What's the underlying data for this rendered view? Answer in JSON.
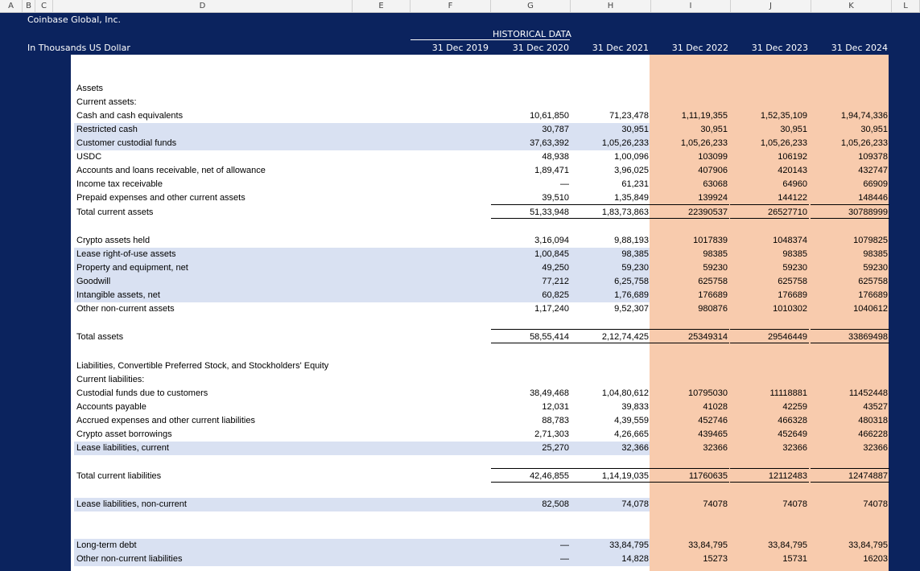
{
  "columns": [
    "A",
    "B",
    "C",
    "D",
    "E",
    "F",
    "G",
    "H",
    "I",
    "J",
    "K",
    "L"
  ],
  "company": "Coinbase Global, Inc.",
  "units": "In Thousands US Dollar",
  "historical_label": "HISTORICAL DATA",
  "periods": [
    "31 Dec 2019",
    "31 Dec 2020",
    "31 Dec 2021",
    "31 Dec 2022",
    "31 Dec 2023",
    "31 Dec 2024"
  ],
  "rows": [
    {
      "label": "Assets",
      "g": "",
      "h": "",
      "i": "",
      "j": "",
      "k": ""
    },
    {
      "label": "Current assets:",
      "g": "",
      "h": "",
      "i": "",
      "j": "",
      "k": ""
    },
    {
      "label": "Cash and cash equivalents",
      "g": "10,61,850",
      "h": "71,23,478",
      "i": "1,11,19,355",
      "j": "1,52,35,109",
      "k": "1,94,74,336"
    },
    {
      "label": "Restricted cash",
      "g": "30,787",
      "h": "30,951",
      "i": "30,951",
      "j": "30,951",
      "k": "30,951"
    },
    {
      "label": "Customer custodial funds",
      "g": "37,63,392",
      "h": "1,05,26,233",
      "i": "1,05,26,233",
      "j": "1,05,26,233",
      "k": "1,05,26,233"
    },
    {
      "label": "USDC",
      "g": "48,938",
      "h": "1,00,096",
      "i": "103099",
      "j": "106192",
      "k": "109378"
    },
    {
      "label": "Accounts and loans receivable, net of allowance",
      "g": "1,89,471",
      "h": "3,96,025",
      "i": "407906",
      "j": "420143",
      "k": "432747"
    },
    {
      "label": "Income tax receivable",
      "g": "—",
      "h": "61,231",
      "i": "63068",
      "j": "64960",
      "k": "66909"
    },
    {
      "label": "Prepaid expenses and other current assets",
      "g": "39,510",
      "h": "1,35,849",
      "i": "139924",
      "j": "144122",
      "k": "148446"
    },
    {
      "label": "Total current assets",
      "g": "51,33,948",
      "h": "1,83,73,863",
      "i": "22390537",
      "j": "26527710",
      "k": "30788999"
    },
    {
      "label": "Crypto assets held",
      "g": "3,16,094",
      "h": "9,88,193",
      "i": "1017839",
      "j": "1048374",
      "k": "1079825"
    },
    {
      "label": "Lease right-of-use assets",
      "g": "1,00,845",
      "h": "98,385",
      "i": "98385",
      "j": "98385",
      "k": "98385"
    },
    {
      "label": "Property and equipment, net",
      "g": "49,250",
      "h": "59,230",
      "i": "59230",
      "j": "59230",
      "k": "59230"
    },
    {
      "label": "Goodwill",
      "g": "77,212",
      "h": "6,25,758",
      "i": "625758",
      "j": "625758",
      "k": "625758"
    },
    {
      "label": "Intangible assets, net",
      "g": "60,825",
      "h": "1,76,689",
      "i": "176689",
      "j": "176689",
      "k": "176689"
    },
    {
      "label": "Other non-current assets",
      "g": "1,17,240",
      "h": "9,52,307",
      "i": "980876",
      "j": "1010302",
      "k": "1040612"
    },
    {
      "label": "Total assets",
      "g": "58,55,414",
      "h": "2,12,74,425",
      "i": "25349314",
      "j": "29546449",
      "k": "33869498"
    },
    {
      "label": "Liabilities, Convertible Preferred Stock, and Stockholders' Equity",
      "g": "",
      "h": "",
      "i": "",
      "j": "",
      "k": ""
    },
    {
      "label": "Current liabilities:",
      "g": "",
      "h": "",
      "i": "",
      "j": "",
      "k": ""
    },
    {
      "label": "Custodial funds due to customers",
      "g": "38,49,468",
      "h": "1,04,80,612",
      "i": "10795030",
      "j": "11118881",
      "k": "11452448"
    },
    {
      "label": "Accounts payable",
      "g": "12,031",
      "h": "39,833",
      "i": "41028",
      "j": "42259",
      "k": "43527"
    },
    {
      "label": "Accrued expenses and other current liabilities",
      "g": "88,783",
      "h": "4,39,559",
      "i": "452746",
      "j": "466328",
      "k": "480318"
    },
    {
      "label": "Crypto asset borrowings",
      "g": "2,71,303",
      "h": "4,26,665",
      "i": "439465",
      "j": "452649",
      "k": "466228"
    },
    {
      "label": "Lease liabilities, current",
      "g": "25,270",
      "h": "32,366",
      "i": "32366",
      "j": "32366",
      "k": "32366"
    },
    {
      "label": "Total current liabilities",
      "g": "42,46,855",
      "h": "1,14,19,035",
      "i": "11760635",
      "j": "12112483",
      "k": "12474887"
    },
    {
      "label": "Lease liabilities, non-current",
      "g": "82,508",
      "h": "74,078",
      "i": "74078",
      "j": "74078",
      "k": "74078"
    },
    {
      "label": "Long-term debt",
      "g": "—",
      "h": "33,84,795",
      "i": "33,84,795",
      "j": "33,84,795",
      "k": "33,84,795"
    },
    {
      "label": "Other non-current liabilities",
      "g": "—",
      "h": "14,828",
      "i": "15273",
      "j": "15731",
      "k": "16203"
    }
  ]
}
